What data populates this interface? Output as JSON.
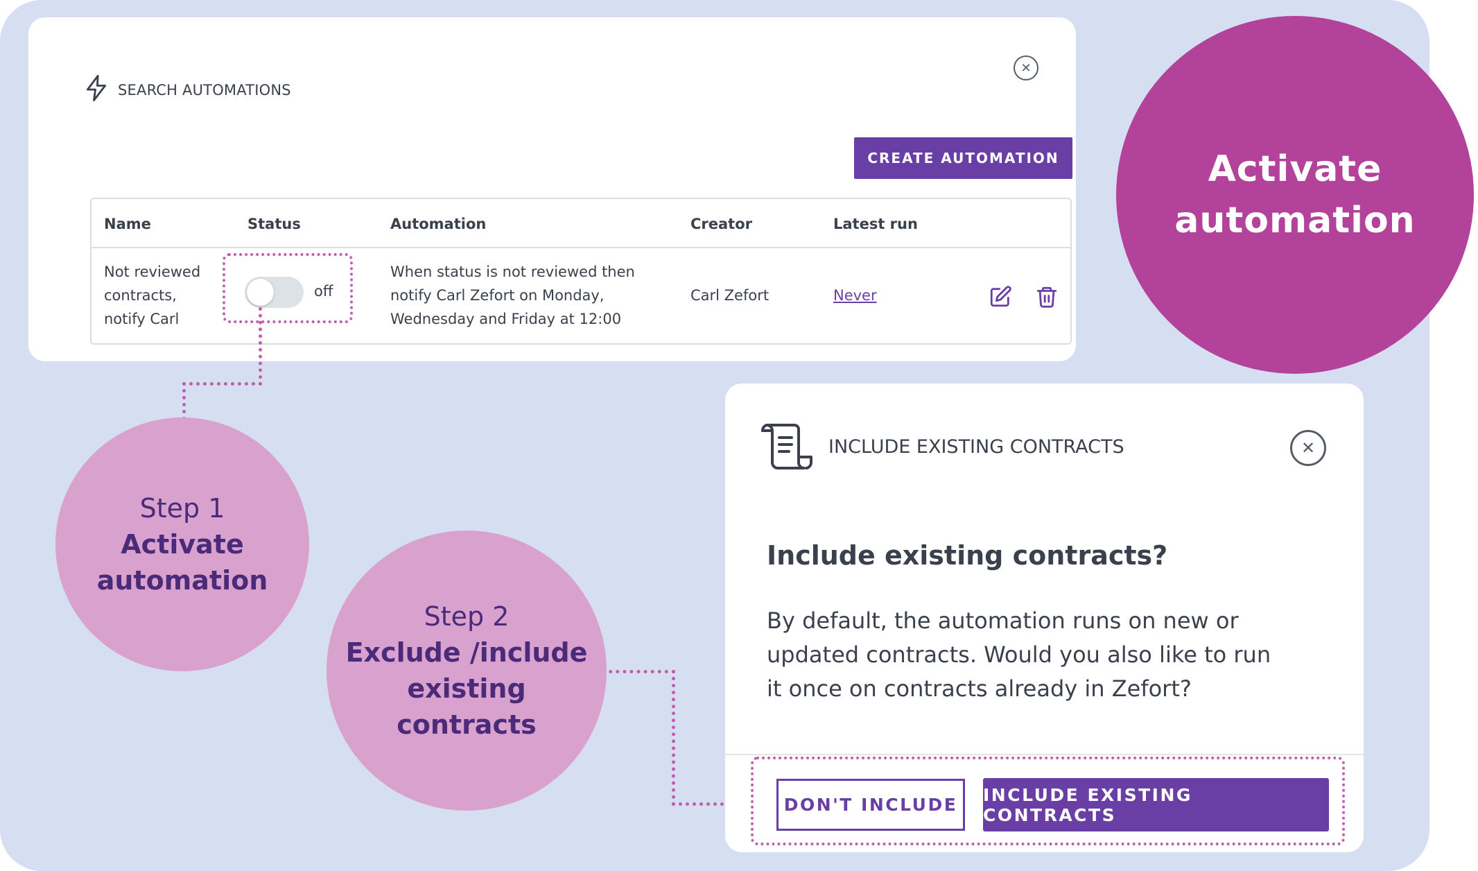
{
  "automations_panel": {
    "title": "SEARCH AUTOMATIONS",
    "create_button": "CREATE AUTOMATION",
    "table": {
      "headers": [
        "Name",
        "Status",
        "Automation",
        "Creator",
        "Latest run"
      ],
      "rows": [
        {
          "name_lines": [
            "Not reviewed",
            "contracts,",
            "notify Carl"
          ],
          "status": "off",
          "automation_lines": [
            "When status is not reviewed then",
            "notify Carl Zefort on Monday,",
            "Wednesday and Friday at 12:00"
          ],
          "creator": "Carl Zefort",
          "latest_run": "Never"
        }
      ]
    }
  },
  "callout_main": {
    "lines": [
      "Activate",
      "automation"
    ]
  },
  "step1": {
    "step": "Step 1",
    "lines": [
      "Activate",
      "automation"
    ]
  },
  "step2": {
    "step": "Step 2",
    "lines": [
      "Exclude /include",
      "existing",
      "contracts"
    ]
  },
  "dialog": {
    "title": "INCLUDE EXISTING CONTRACTS",
    "heading": "Include existing contracts?",
    "body_lines": [
      "By default, the automation runs on new or",
      "updated contracts. Would you also like to run",
      "it once on contracts already in Zefort?"
    ],
    "dont_include": "DON'T INCLUDE",
    "include": "INCLUDE EXISTING CONTRACTS"
  },
  "icons": {
    "automation": "lightning-icon",
    "close": "close-icon",
    "edit": "edit-icon",
    "delete": "trash-icon",
    "dialog": "scroll-document-icon"
  },
  "colors": {
    "background": "#d6dff1",
    "primary": "#6a3fa5",
    "magenta": "#b3429b",
    "pink": "#d9a1cd",
    "dotted": "#c35cb0"
  }
}
